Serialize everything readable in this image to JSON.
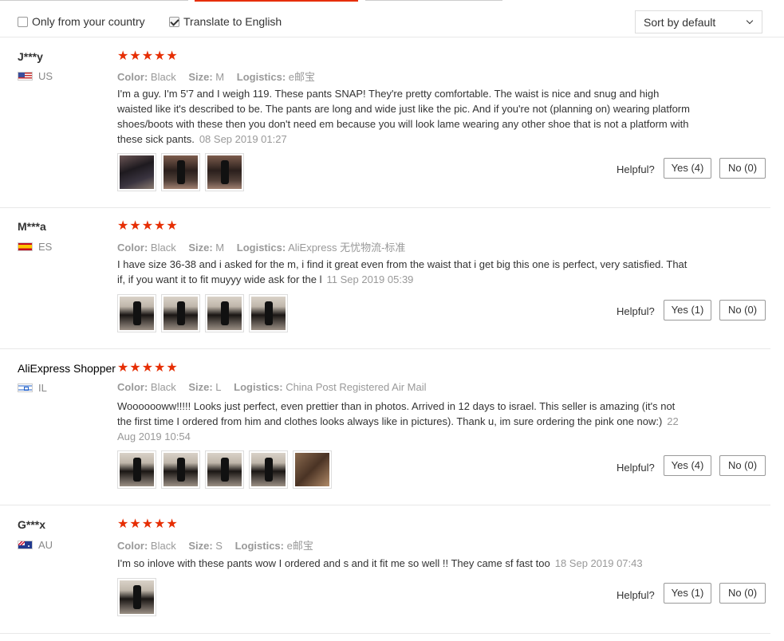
{
  "filters": {
    "only_country_label": "Only from your country",
    "only_country_checked": false,
    "translate_label": "Translate to English",
    "translate_checked": true,
    "sort_label": "Sort by default"
  },
  "helpful_label": "Helpful?",
  "meta_labels": {
    "color": "Color:",
    "size": "Size:",
    "logistics": "Logistics:"
  },
  "reviews": [
    {
      "user": "J***y",
      "country": "US",
      "rating": 5,
      "color": "Black",
      "size": "M",
      "logistics": "e邮宝",
      "text": "I'm a guy. I'm 5'7 and I weigh 119. These pants SNAP! They're pretty comfortable. The waist is nice and snug and high waisted like it's described to be. The pants are long and wide just like the pic. And if you're not (planning on) wearing platform shoes/boots with these then you don't need em because you will look lame wearing any other shoe that is not a platform with these sick pants.",
      "date": "08 Sep 2019 01:27",
      "photos": 3,
      "yes": "Yes (4)",
      "no": "No (0)"
    },
    {
      "user": "M***a",
      "country": "ES",
      "rating": 5,
      "color": "Black",
      "size": "M",
      "logistics": "AliExpress 无忧物流-标准",
      "text": "I have size 36-38 and i asked for the m, i find it great even from the waist that i get big this one is perfect, very satisfied. That if, if you want it to fit muyyy wide ask for the l",
      "date": "11 Sep 2019 05:39",
      "photos": 4,
      "yes": "Yes (1)",
      "no": "No (0)"
    },
    {
      "user": "AliExpress Shopper",
      "country": "IL",
      "rating": 5,
      "color": "Black",
      "size": "L",
      "logistics": "China Post Registered Air Mail",
      "text": "Wooooooww!!!!! Looks just perfect, even prettier than in photos. Arrived in 12 days to israel. This seller is amazing (it's not the first time I ordered from him and clothes looks always like in pictures). Thank u, im sure ordering the pink one now:)",
      "date": "22 Aug 2019 10:54",
      "photos": 5,
      "yes": "Yes (4)",
      "no": "No (0)"
    },
    {
      "user": "G***x",
      "country": "AU",
      "rating": 5,
      "color": "Black",
      "size": "S",
      "logistics": "e邮宝",
      "text": "I'm so inlove with these pants wow I ordered and s and it fit me so well !! They came sf fast too",
      "date": "18 Sep 2019 07:43",
      "photos": 1,
      "yes": "Yes (1)",
      "no": "No (0)"
    }
  ]
}
